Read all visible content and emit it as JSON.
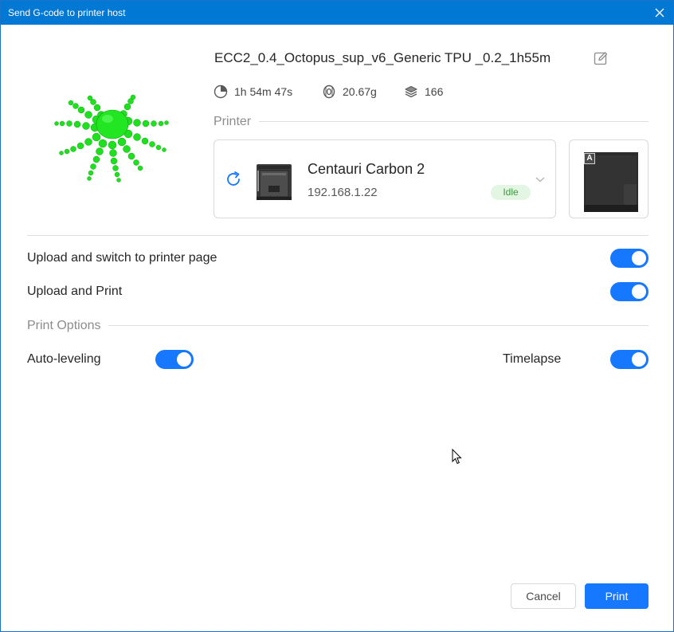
{
  "window": {
    "title": "Send G-code to printer host"
  },
  "file": {
    "name": "ECC2_0.4_Octopus_sup_v6_Generic TPU _0.2_1h55m",
    "print_time": "1h 54m 47s",
    "filament_weight": "20.67g",
    "layers": "166"
  },
  "printer_section": {
    "label": "Printer"
  },
  "printer": {
    "name": "Centauri Carbon 2",
    "ip": "192.168.1.22",
    "status": "Idle"
  },
  "camera": {
    "tag": "A"
  },
  "options": {
    "upload_switch_label": "Upload and switch to printer page",
    "upload_switch_on": true,
    "upload_print_label": "Upload and Print",
    "upload_print_on": true
  },
  "print_options": {
    "label": "Print Options",
    "auto_leveling_label": "Auto-leveling",
    "auto_leveling_on": true,
    "timelapse_label": "Timelapse",
    "timelapse_on": true
  },
  "buttons": {
    "cancel": "Cancel",
    "print": "Print"
  },
  "colors": {
    "titlebar": "#0078d4",
    "accent": "#1677ff",
    "model": "#1fe01f",
    "status_bg": "#e3f5e3",
    "status_fg": "#3a9b3a"
  }
}
